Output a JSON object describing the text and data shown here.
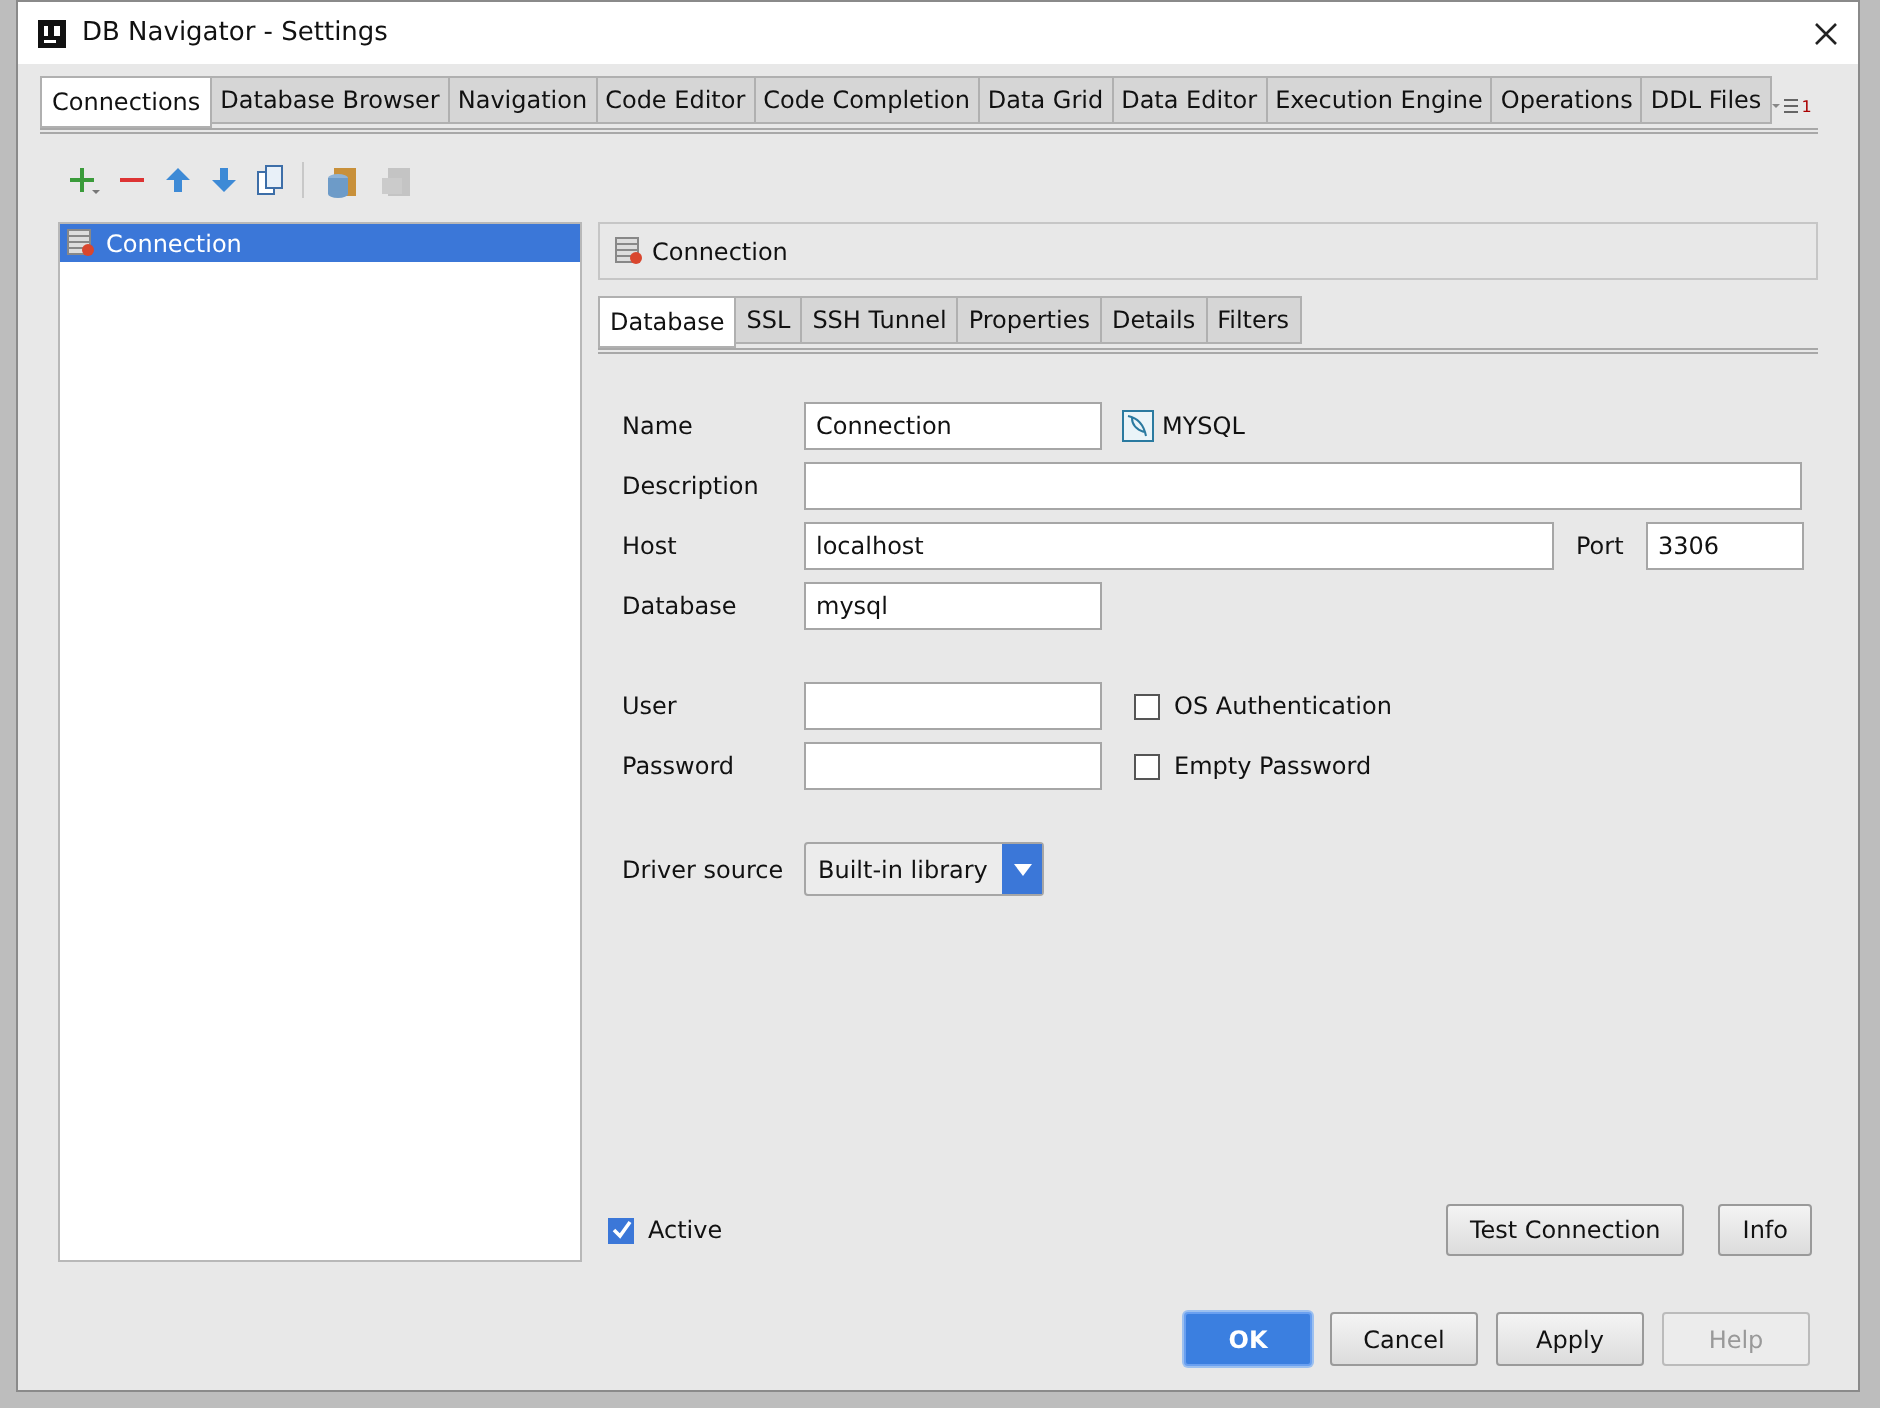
{
  "window": {
    "title": "DB Navigator - Settings"
  },
  "tabs": [
    {
      "label": "Connections",
      "selected": true
    },
    {
      "label": "Database Browser",
      "selected": false
    },
    {
      "label": "Navigation",
      "selected": false
    },
    {
      "label": "Code Editor",
      "selected": false
    },
    {
      "label": "Code Completion",
      "selected": false
    },
    {
      "label": "Data Grid",
      "selected": false
    },
    {
      "label": "Data Editor",
      "selected": false
    },
    {
      "label": "Execution Engine",
      "selected": false
    },
    {
      "label": "Operations",
      "selected": false
    },
    {
      "label": "DDL Files",
      "selected": false
    }
  ],
  "tab_overflow_count": "1",
  "connections": [
    {
      "name": "Connection",
      "selected": true
    }
  ],
  "panel_title": "Connection",
  "subtabs": [
    {
      "label": "Database",
      "selected": true
    },
    {
      "label": "SSL",
      "selected": false
    },
    {
      "label": "SSH Tunnel",
      "selected": false
    },
    {
      "label": "Properties",
      "selected": false
    },
    {
      "label": "Details",
      "selected": false
    },
    {
      "label": "Filters",
      "selected": false
    }
  ],
  "form": {
    "name": {
      "label": "Name",
      "value": "Connection"
    },
    "db_type": "MYSQL",
    "description": {
      "label": "Description"
    },
    "host": {
      "label": "Host",
      "value": "localhost"
    },
    "port": {
      "label": "Port",
      "value": "3306"
    },
    "database": {
      "label": "Database",
      "value": "mysql"
    },
    "user": {
      "label": "User"
    },
    "password": {
      "label": "Password"
    },
    "os_auth": {
      "label": "OS Authentication",
      "checked": false
    },
    "empty_password": {
      "label": "Empty Password",
      "checked": false
    },
    "driver_source": {
      "label": "Driver source",
      "value": "Built-in library"
    },
    "active": {
      "label": "Active",
      "checked": true
    }
  },
  "panel_buttons": [
    "Test Connection",
    "Info"
  ],
  "footer_buttons": [
    {
      "label": "OK",
      "primary": true,
      "disabled": false
    },
    {
      "label": "Cancel",
      "primary": false,
      "disabled": false
    },
    {
      "label": "Apply",
      "primary": false,
      "disabled": false
    },
    {
      "label": "Help",
      "primary": false,
      "disabled": true
    }
  ]
}
